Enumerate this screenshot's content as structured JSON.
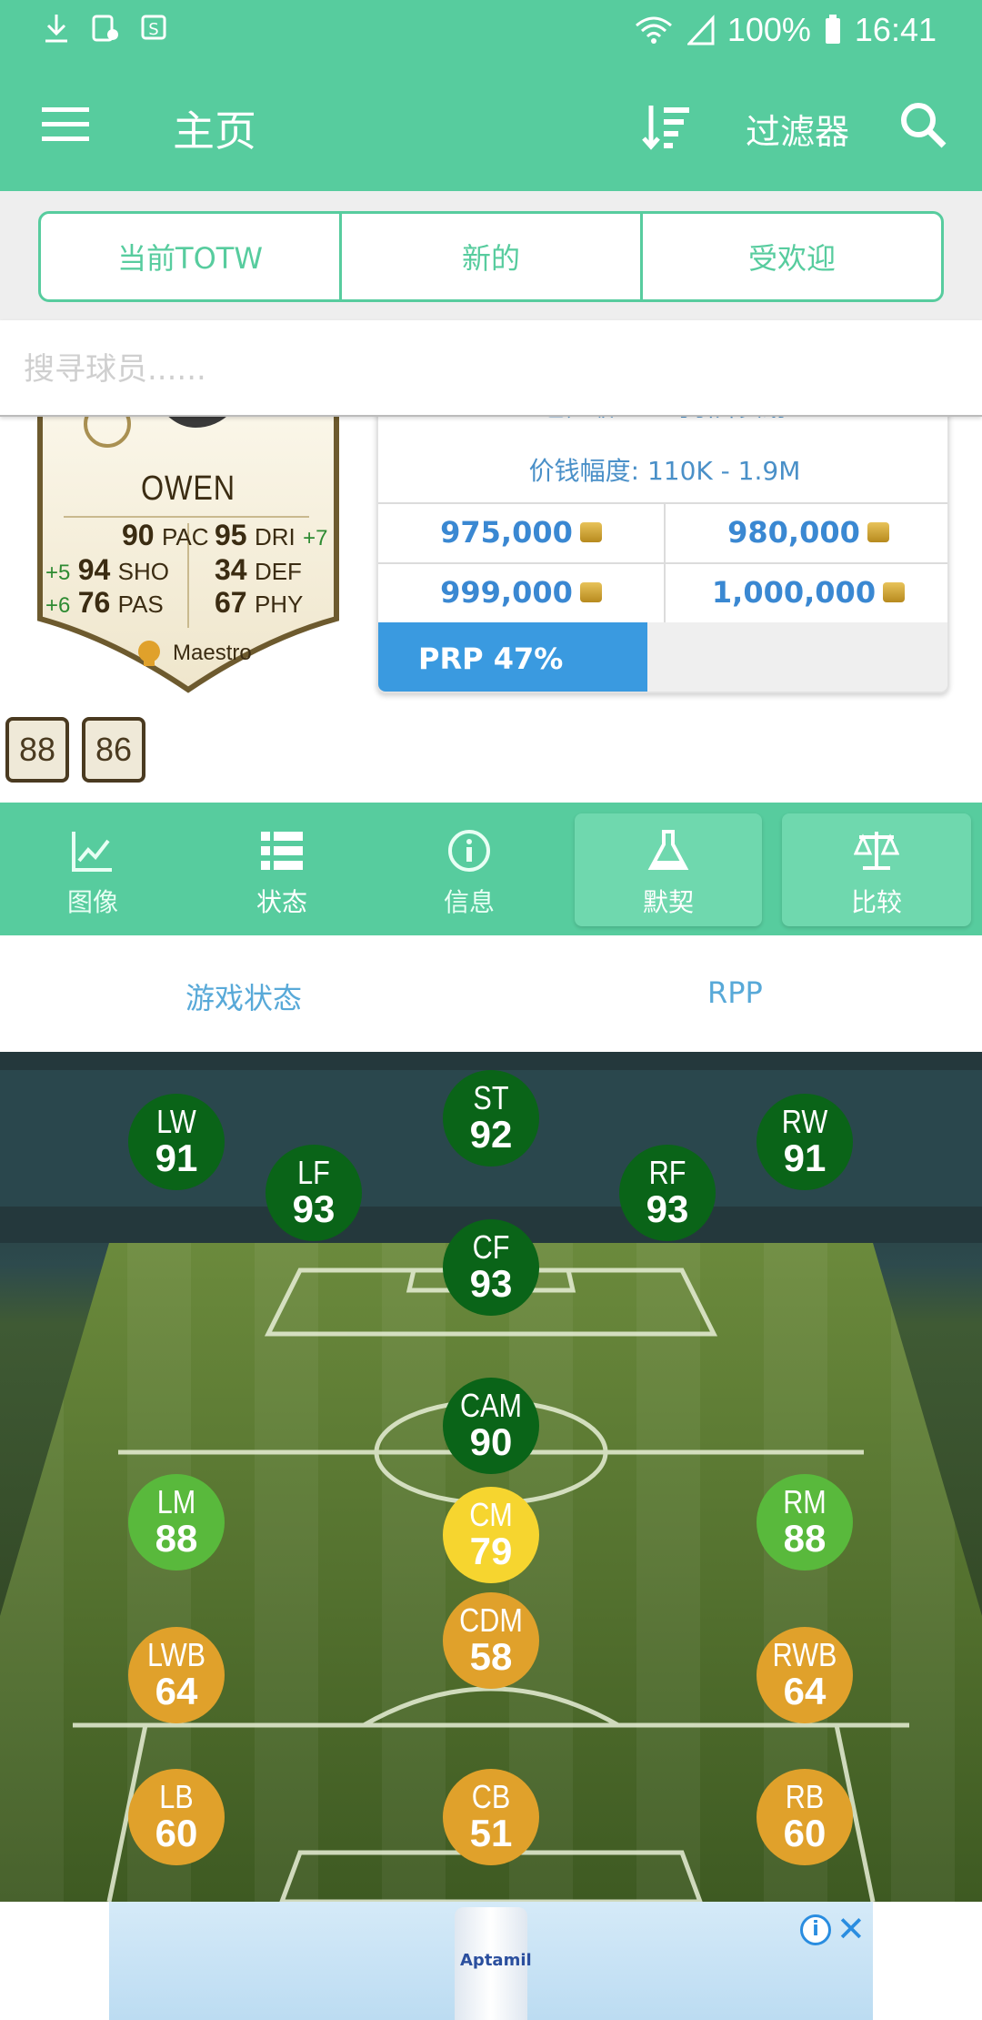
{
  "status_bar": {
    "battery": "100%",
    "time": "16:41"
  },
  "app_bar": {
    "title": "主页",
    "filter_label": "过滤器"
  },
  "tabs": [
    {
      "label": "当前TOTW"
    },
    {
      "label": "新的"
    },
    {
      "label": "受欢迎"
    }
  ],
  "search": {
    "placeholder": "搜寻球员......"
  },
  "player_card": {
    "name": "OWEN",
    "stats": [
      {
        "value": "90",
        "label": "PAC",
        "boost": ""
      },
      {
        "value": "95",
        "label": "DRI",
        "boost": "+7"
      },
      {
        "value": "94",
        "label": "SHO",
        "boost": "+5"
      },
      {
        "value": "34",
        "label": "DEF",
        "boost": ""
      },
      {
        "value": "76",
        "label": "PAS",
        "boost": "+6"
      },
      {
        "value": "67",
        "label": "PHY",
        "boost": ""
      }
    ],
    "chem_style": "Maestro",
    "other_ratings": [
      "88",
      "86"
    ]
  },
  "price_panel": {
    "partial_line": "已声级 · … 可引升页划",
    "range": "价钱幅度: 110K - 1.9M",
    "prices": [
      "975,000",
      "980,000",
      "999,000",
      "1,000,000"
    ],
    "prp": "PRP 47%"
  },
  "detail_nav": [
    {
      "label": "图像",
      "icon": "chart-icon"
    },
    {
      "label": "状态",
      "icon": "list-icon"
    },
    {
      "label": "信息",
      "icon": "info-icon"
    },
    {
      "label": "默契",
      "icon": "flask-icon"
    },
    {
      "label": "比较",
      "icon": "scale-icon"
    }
  ],
  "sub_tabs": [
    {
      "label": "游戏状态"
    },
    {
      "label": "RPP"
    }
  ],
  "positions": [
    {
      "pos": "ST",
      "rating": "92",
      "tier": "dark"
    },
    {
      "pos": "LW",
      "rating": "91",
      "tier": "dark"
    },
    {
      "pos": "RW",
      "rating": "91",
      "tier": "dark"
    },
    {
      "pos": "LF",
      "rating": "93",
      "tier": "dark"
    },
    {
      "pos": "RF",
      "rating": "93",
      "tier": "dark"
    },
    {
      "pos": "CF",
      "rating": "93",
      "tier": "dark"
    },
    {
      "pos": "CAM",
      "rating": "90",
      "tier": "dark"
    },
    {
      "pos": "LM",
      "rating": "88",
      "tier": "mid"
    },
    {
      "pos": "CM",
      "rating": "79",
      "tier": "yellow"
    },
    {
      "pos": "RM",
      "rating": "88",
      "tier": "mid"
    },
    {
      "pos": "LWB",
      "rating": "64",
      "tier": "orange"
    },
    {
      "pos": "CDM",
      "rating": "58",
      "tier": "orange"
    },
    {
      "pos": "RWB",
      "rating": "64",
      "tier": "orange"
    },
    {
      "pos": "LB",
      "rating": "60",
      "tier": "orange"
    },
    {
      "pos": "CB",
      "rating": "51",
      "tier": "orange"
    },
    {
      "pos": "RB",
      "rating": "60",
      "tier": "orange"
    }
  ],
  "ad": {
    "product": "Aptamil",
    "info": "i"
  },
  "colors": {
    "primary": "#57cc9e",
    "blue": "#3a9ae0",
    "dark_green": "#0a6418",
    "light_green": "#59b93c",
    "yellow": "#f6d52f",
    "orange": "#e0a12b"
  }
}
